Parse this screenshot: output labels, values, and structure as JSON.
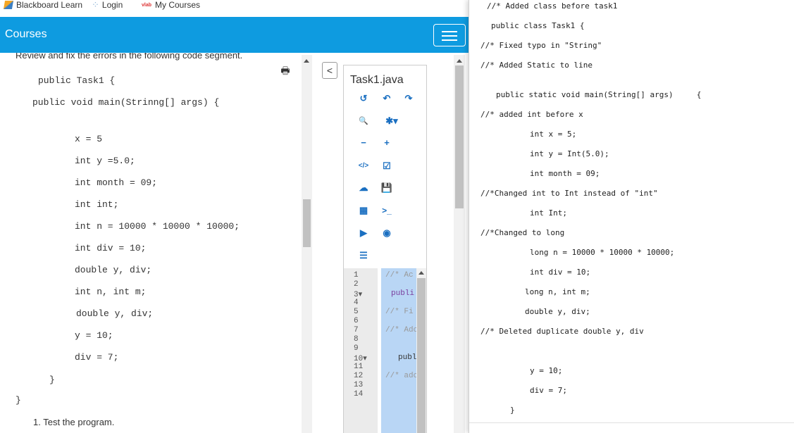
{
  "bookmarks": [
    {
      "label": "Blackboard Learn",
      "icon": "blackboard-icon"
    },
    {
      "label": "Login",
      "icon": "login-icon"
    },
    {
      "label": "My Courses",
      "icon": "vlab-icon",
      "icon_text": "vlab"
    }
  ],
  "header": {
    "title": "Courses",
    "menu_icon": "hamburger-icon"
  },
  "left_pane": {
    "intro": "Review and fix the errors in the following code segment.",
    "code_lines": [
      "public Task1 {",
      "public void main(Strinng[] args) {",
      "x = 5",
      "int y =5.0;",
      "int month = 09;",
      "int int;",
      "int n = 10000 * 10000 * 10000;",
      "int div = 10;",
      "double y, div;",
      "int n, int m;",
      "double y, div;",
      "y = 10;",
      "div = 7;",
      "}",
      "}"
    ],
    "step": "1. Test the program."
  },
  "editor": {
    "filename": "Task1.java",
    "toolbar": [
      "↺",
      "↶",
      "↷",
      "🔍",
      "✱▾",
      "−",
      "+",
      "</>",
      "☑",
      "☁",
      "💾",
      "▦",
      ">_",
      "▶",
      "◉",
      "☰"
    ],
    "line_numbers": [
      "1",
      "2",
      "3▾",
      "4",
      "5",
      "6",
      "7",
      "8",
      "9",
      "10▾",
      "11",
      "12",
      "13",
      "14"
    ],
    "lines": [
      "//* Ac",
      "",
      "publi",
      "",
      "//* Fi",
      "",
      "//* Adc",
      "",
      "",
      "publ",
      "",
      "//* adc",
      "",
      ""
    ]
  },
  "right_pane": {
    "lines": [
      "//* Added class before task1",
      "public class Task1 {",
      "//* Fixed typo in \"String\"",
      "//* Added Static to line",
      "public static void main(String[] args)     {",
      "//* added int before x",
      "int x = 5;",
      "int y = Int(5.0);",
      "int month = 09;",
      "//*Changed int to Int instead of \"int\"",
      "int Int;",
      "//*Changed to long",
      "long n = 10000 * 10000 * 10000;",
      "int div = 10;",
      "long n, int m;",
      "double y, div;",
      "//* Deleted duplicate double y, div",
      "y = 10;",
      "div = 7;",
      "}"
    ]
  },
  "colors": {
    "header_bg": "#0e9be0",
    "editor_selection": "#b9d6f5",
    "toolbar_icon": "#1a6fc1",
    "comment": "#999999",
    "keyword": "#7a3e9d"
  }
}
